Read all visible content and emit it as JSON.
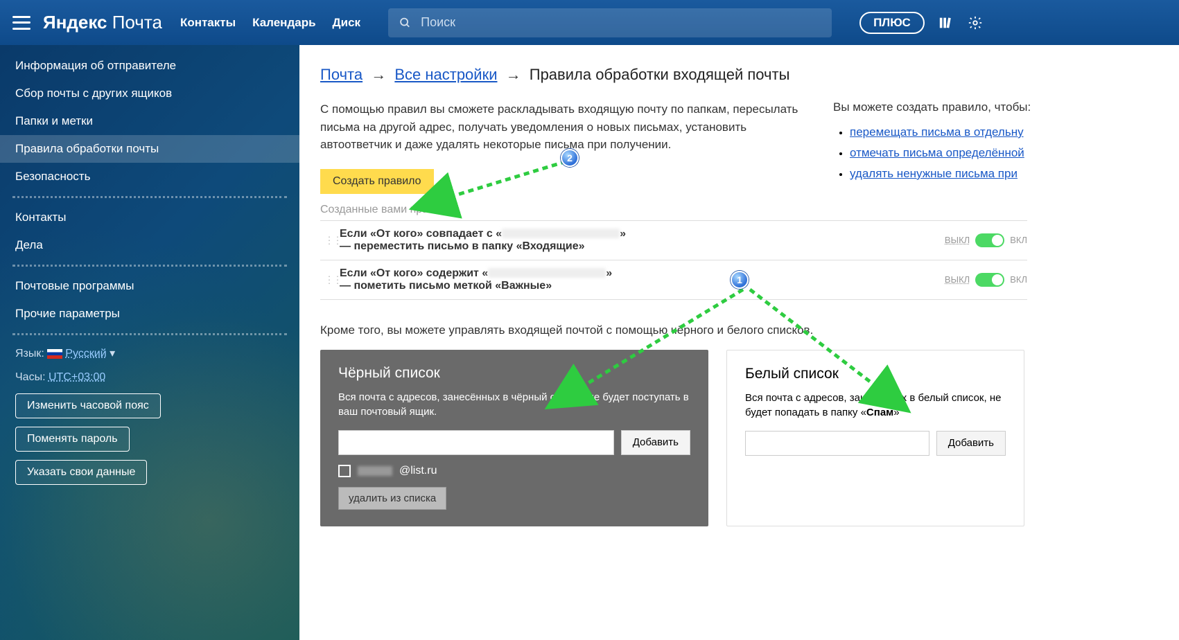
{
  "header": {
    "logo_brand": "Яндекс",
    "logo_product": "Почта",
    "nav": {
      "contacts": "Контакты",
      "calendar": "Календарь",
      "disk": "Диск"
    },
    "search_placeholder": "Поиск",
    "plus": "ПЛЮС"
  },
  "sidebar": {
    "items": [
      "Информация об отправителе",
      "Сбор почты с других ящиков",
      "Папки и метки",
      "Правила обработки почты",
      "Безопасность"
    ],
    "group2": [
      "Контакты",
      "Дела"
    ],
    "group3": [
      "Почтовые программы",
      "Прочие параметры"
    ],
    "lang_label": "Язык:",
    "lang_value": "Русский",
    "clock_label": "Часы:",
    "clock_value": "UTC+03:00",
    "btn_tz": "Изменить часовой пояс",
    "btn_pwd": "Поменять пароль",
    "btn_data": "Указать свои данные"
  },
  "breadcrumb": {
    "mail": "Почта",
    "settings": "Все настройки",
    "current": "Правила обработки входящей почты"
  },
  "intro": "С помощью правил вы сможете раскладывать входящую почту по папкам, пересылать письма на другой адрес, получать уведомления о новых письмах, установить автоответчик и даже удалять некоторые письма при получении.",
  "create_rule": "Создать правило",
  "rules_label": "Созданные вами правила",
  "rules": [
    {
      "cond_pre": "Если «От кого» совпадает с «",
      "cond_post": "»",
      "action": "— переместить письмо в папку «Входящие»"
    },
    {
      "cond_pre": "Если «От кого» содержит «",
      "cond_post": "»",
      "action": "— пометить письмо меткой «Важные»"
    }
  ],
  "toggle": {
    "off": "ВЫКЛ",
    "on": "ВКЛ"
  },
  "right": {
    "intro": "Вы можете создать правило, чтобы:",
    "links": [
      "перемещать письма в отдельну",
      "отмечать письма определённой",
      "удалять ненужные письма при"
    ]
  },
  "lists_intro": "Кроме того, вы можете управлять входящей почтой с помощью чёрного и белого списков.",
  "black": {
    "title": "Чёрный список",
    "desc": "Вся почта с адресов, занесённых в чёрный список, не будет поступать в ваш почтовый ящик.",
    "add": "Добавить",
    "entry": "@list.ru",
    "remove": "удалить из списка"
  },
  "white": {
    "title": "Белый список",
    "desc_pre": "Вся почта с адресов, занесённых в белый список, не будет попадать в папку «",
    "desc_bold": "Спам",
    "desc_post": "»",
    "add": "Добавить"
  }
}
